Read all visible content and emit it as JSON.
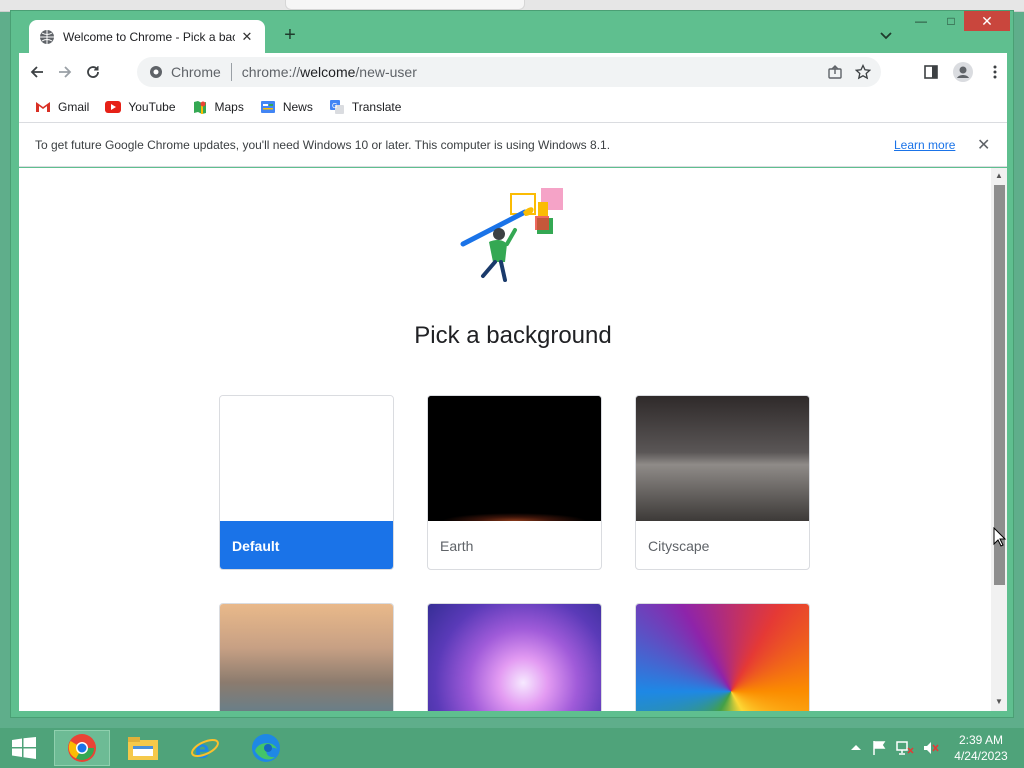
{
  "tab": {
    "title": "Welcome to Chrome - Pick a background",
    "close": "✕"
  },
  "new_tab": "+",
  "window_controls": {
    "minimize": "—",
    "maximize": "□",
    "close": "✕"
  },
  "omnibox": {
    "label": "Chrome",
    "url_scheme": "chrome://",
    "url_host": "welcome",
    "url_path": "/new-user"
  },
  "bookmarks": [
    {
      "label": "Gmail",
      "icon": "gmail-icon"
    },
    {
      "label": "YouTube",
      "icon": "youtube-icon"
    },
    {
      "label": "Maps",
      "icon": "maps-icon"
    },
    {
      "label": "News",
      "icon": "news-icon"
    },
    {
      "label": "Translate",
      "icon": "translate-icon"
    }
  ],
  "infobar": {
    "message": "To get future Google Chrome updates, you'll need Windows 10 or later. This computer is using Windows 8.1.",
    "link": "Learn more",
    "close": "✕"
  },
  "page": {
    "heading": "Pick a background",
    "cards": [
      {
        "label": "Default",
        "selected": true
      },
      {
        "label": "Earth",
        "selected": false
      },
      {
        "label": "Cityscape",
        "selected": false
      },
      {
        "label": "",
        "selected": false
      },
      {
        "label": "",
        "selected": false
      },
      {
        "label": "",
        "selected": false
      }
    ]
  },
  "taskbar": {
    "apps": [
      "windows-start-icon",
      "chrome-icon",
      "file-explorer-icon",
      "internet-explorer-icon",
      "edge-icon"
    ],
    "time": "2:39 AM",
    "date": "4/24/2023"
  },
  "colors": {
    "accent": "#1a73e8",
    "frame": "#5fbf8f",
    "taskbar": "#4fa37a"
  }
}
